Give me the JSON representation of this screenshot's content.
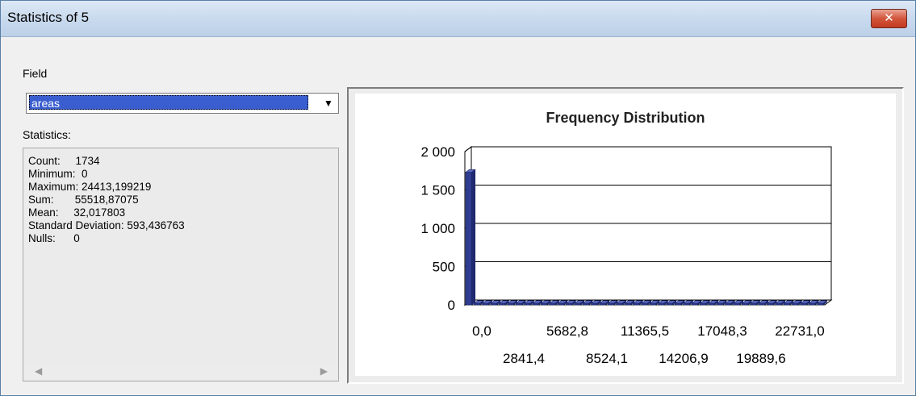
{
  "window": {
    "title": "Statistics of 5",
    "close_icon": "close-icon"
  },
  "field": {
    "label": "Field",
    "selected": "areas"
  },
  "statistics": {
    "label": "Statistics:",
    "lines": [
      "Count:     1734",
      "Minimum:  0",
      "Maximum: 24413,199219",
      "Sum:       55518,87075",
      "Mean:     32,017803",
      "Standard Deviation: 593,436763",
      "Nulls:      0"
    ]
  },
  "chart_data": {
    "type": "bar",
    "title": "Frequency Distribution",
    "ylim": [
      0,
      2000
    ],
    "y_ticks": [
      "2 000",
      "1 500",
      "1 000",
      "500",
      "0"
    ],
    "x_tick_labels_row1": [
      "0,0",
      "5682,8",
      "11365,5",
      "17048,3",
      "22731,0"
    ],
    "x_tick_labels_row2": [
      "2841,4",
      "8524,1",
      "14206,9",
      "19889,6"
    ],
    "bin_count": 43,
    "values": [
      1730,
      0,
      0,
      0,
      0,
      0,
      0,
      0,
      0,
      0,
      0,
      0,
      0,
      0,
      0,
      0,
      0,
      0,
      0,
      0,
      0,
      0,
      0,
      0,
      0,
      0,
      0,
      0,
      0,
      0,
      0,
      0,
      0,
      0,
      0,
      0,
      0,
      0,
      0,
      0,
      0,
      0,
      0
    ],
    "bar_color": "#2f3d91"
  }
}
